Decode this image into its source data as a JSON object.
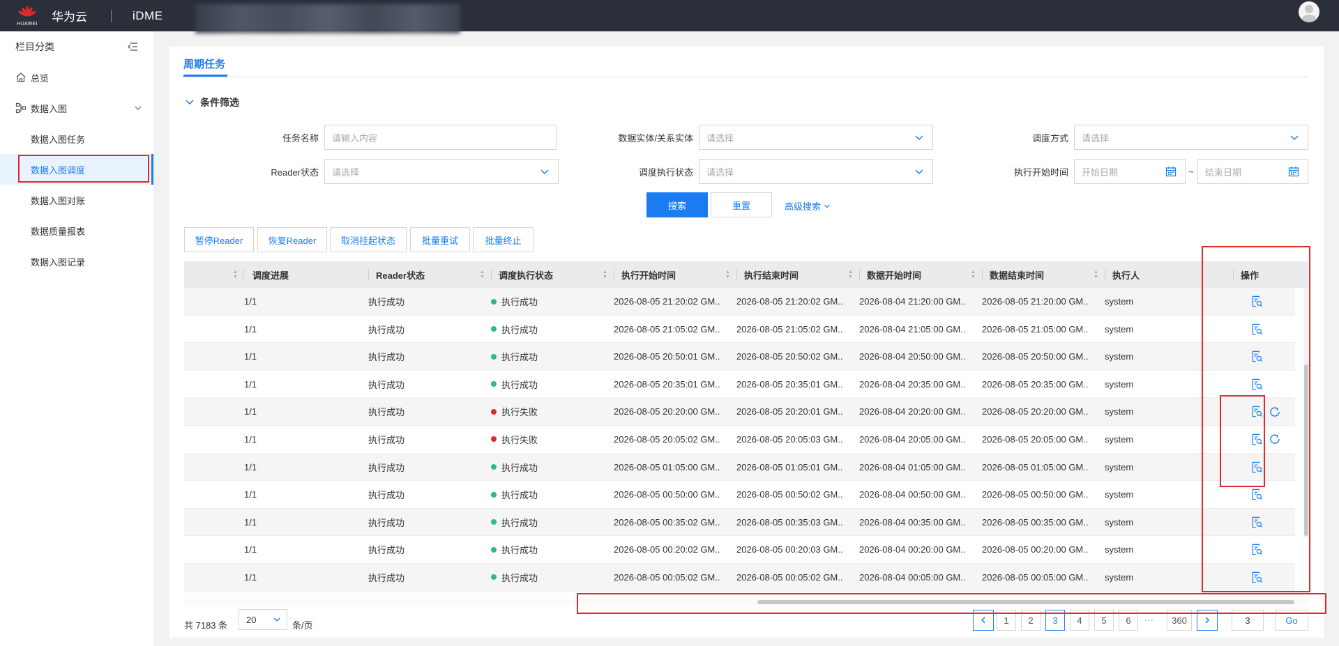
{
  "header": {
    "logo_text": "HUAWEI",
    "brand": "华为云",
    "product": "iDME"
  },
  "sidebar": {
    "title": "栏目分类",
    "items": [
      {
        "label": "总览",
        "icon": "home-icon"
      },
      {
        "label": "数据入图",
        "icon": "graph-icon"
      }
    ],
    "sub_items": [
      {
        "label": "数据入图任务",
        "active": false
      },
      {
        "label": "数据入图调度",
        "active": true
      },
      {
        "label": "数据入图对账",
        "active": false
      },
      {
        "label": "数据质量报表",
        "active": false
      },
      {
        "label": "数据入图记录",
        "active": false
      }
    ]
  },
  "main": {
    "tab": "周期任务",
    "filter_title": "条件筛选",
    "filters": {
      "task_name_label": "任务名称",
      "task_name_placeholder": "请输入内容",
      "entity_label": "数据实体/关系实体",
      "entity_placeholder": "请选择",
      "schedule_mode_label": "调度方式",
      "schedule_mode_placeholder": "请选择",
      "reader_status_label": "Reader状态",
      "reader_status_placeholder": "请选择",
      "exec_status_label": "调度执行状态",
      "exec_status_placeholder": "请选择",
      "start_time_label": "执行开始时间",
      "start_date_placeholder": "开始日期",
      "range_sep": "~",
      "end_date_placeholder": "结束日期"
    },
    "buttons": {
      "search": "搜索",
      "reset": "重置",
      "advanced": "高级搜索"
    },
    "actions": [
      "暂停Reader",
      "恢复Reader",
      "取消挂起状态",
      "批量重试",
      "批量终止"
    ],
    "table": {
      "columns": [
        "调度进展",
        "Reader状态",
        "调度执行状态",
        "执行开始时间",
        "执行结束时间",
        "数据开始时间",
        "数据结束时间",
        "执行人",
        "操作"
      ],
      "rows": [
        {
          "progress": "1/1",
          "reader": "执行成功",
          "status": "执行成功",
          "ok": true,
          "exec_start": "2026-08-05 21:20:02 GM..",
          "exec_end": "2026-08-05 21:20:02 GM..",
          "data_start": "2026-08-04 21:20:00 GM..",
          "data_end": "2026-08-05 21:20:00 GM..",
          "user": "system"
        },
        {
          "progress": "1/1",
          "reader": "执行成功",
          "status": "执行成功",
          "ok": true,
          "exec_start": "2026-08-05 21:05:02 GM..",
          "exec_end": "2026-08-05 21:05:02 GM..",
          "data_start": "2026-08-04 21:05:00 GM..",
          "data_end": "2026-08-05 21:05:00 GM..",
          "user": "system"
        },
        {
          "progress": "1/1",
          "reader": "执行成功",
          "status": "执行成功",
          "ok": true,
          "exec_start": "2026-08-05 20:50:01 GM..",
          "exec_end": "2026-08-05 20:50:02 GM..",
          "data_start": "2026-08-04 20:50:00 GM..",
          "data_end": "2026-08-05 20:50:00 GM..",
          "user": "system"
        },
        {
          "progress": "1/1",
          "reader": "执行成功",
          "status": "执行成功",
          "ok": true,
          "exec_start": "2026-08-05 20:35:01 GM..",
          "exec_end": "2026-08-05 20:35:01 GM..",
          "data_start": "2026-08-04 20:35:00 GM..",
          "data_end": "2026-08-05 20:35:00 GM..",
          "user": "system"
        },
        {
          "progress": "1/1",
          "reader": "执行成功",
          "status": "执行失败",
          "ok": false,
          "exec_start": "2026-08-05 20:20:00 GM..",
          "exec_end": "2026-08-05 20:20:01 GM..",
          "data_start": "2026-08-04 20:20:00 GM..",
          "data_end": "2026-08-05 20:20:00 GM..",
          "user": "system"
        },
        {
          "progress": "1/1",
          "reader": "执行成功",
          "status": "执行失败",
          "ok": false,
          "exec_start": "2026-08-05 20:05:02 GM..",
          "exec_end": "2026-08-05 20:05:03 GM..",
          "data_start": "2026-08-04 20:05:00 GM..",
          "data_end": "2026-08-05 20:05:00 GM..",
          "user": "system"
        },
        {
          "progress": "1/1",
          "reader": "执行成功",
          "status": "执行成功",
          "ok": true,
          "exec_start": "2026-08-05 01:05:00 GM..",
          "exec_end": "2026-08-05 01:05:01 GM..",
          "data_start": "2026-08-04 01:05:00 GM..",
          "data_end": "2026-08-05 01:05:00 GM..",
          "user": "system"
        },
        {
          "progress": "1/1",
          "reader": "执行成功",
          "status": "执行成功",
          "ok": true,
          "exec_start": "2026-08-05 00:50:00 GM..",
          "exec_end": "2026-08-05 00:50:02 GM..",
          "data_start": "2026-08-04 00:50:00 GM..",
          "data_end": "2026-08-05 00:50:00 GM..",
          "user": "system"
        },
        {
          "progress": "1/1",
          "reader": "执行成功",
          "status": "执行成功",
          "ok": true,
          "exec_start": "2026-08-05 00:35:02 GM..",
          "exec_end": "2026-08-05 00:35:03 GM..",
          "data_start": "2026-08-04 00:35:00 GM..",
          "data_end": "2026-08-05 00:35:00 GM..",
          "user": "system"
        },
        {
          "progress": "1/1",
          "reader": "执行成功",
          "status": "执行成功",
          "ok": true,
          "exec_start": "2026-08-05 00:20:02 GM..",
          "exec_end": "2026-08-05 00:20:03 GM..",
          "data_start": "2026-08-04 00:20:00 GM..",
          "data_end": "2026-08-05 00:20:00 GM..",
          "user": "system"
        },
        {
          "progress": "1/1",
          "reader": "执行成功",
          "status": "执行成功",
          "ok": true,
          "exec_start": "2026-08-05 00:05:02 GM..",
          "exec_end": "2026-08-05 00:05:02 GM..",
          "data_start": "2026-08-04 00:05:00 GM..",
          "data_end": "2026-08-05 00:05:00 GM..",
          "user": "system"
        }
      ]
    },
    "pagination": {
      "total": "共 7183 条",
      "page_size": "20",
      "per_page": "条/页",
      "pages": [
        "1",
        "2",
        "3",
        "4",
        "5",
        "6"
      ],
      "current": "3",
      "ellipsis": "···",
      "last": "360",
      "goto_value": "3",
      "go": "Go"
    }
  },
  "colors": {
    "accent": "#1a7cf0",
    "success": "#2dbb7f",
    "fail": "#e0292d",
    "topbar": "#2b2f3a",
    "annotation": "#e0292d"
  }
}
